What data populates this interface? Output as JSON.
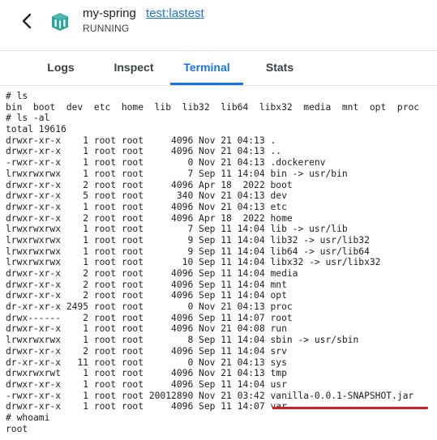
{
  "header": {
    "app_name": "my-spring",
    "image_tag": "test:lastest",
    "status": "RUNNING",
    "back_icon": "chevron-left-icon",
    "app_icon": "container-icon",
    "app_icon_color": "#26a69a"
  },
  "tabs": [
    {
      "label": "Logs"
    },
    {
      "label": "Inspect"
    },
    {
      "label": "Terminal",
      "active": true
    },
    {
      "label": "Stats"
    }
  ],
  "accent_color": "#1a73e8",
  "highlight_color": "#d01c1f",
  "terminal": {
    "lines": [
      "# ls",
      "bin  boot  dev  etc  home  lib  lib32  lib64  libx32  media  mnt  opt  proc",
      "# ls -al",
      "total 19616",
      "drwxr-xr-x    1 root root     4096 Nov 21 04:13 .",
      "drwxr-xr-x    1 root root     4096 Nov 21 04:13 ..",
      "-rwxr-xr-x    1 root root        0 Nov 21 04:13 .dockerenv",
      "lrwxrwxrwx    1 root root        7 Sep 11 14:04 bin -> usr/bin",
      "drwxr-xr-x    2 root root     4096 Apr 18  2022 boot",
      "drwxr-xr-x    5 root root      340 Nov 21 04:13 dev",
      "drwxr-xr-x    1 root root     4096 Nov 21 04:13 etc",
      "drwxr-xr-x    2 root root     4096 Apr 18  2022 home",
      "lrwxrwxrwx    1 root root        7 Sep 11 14:04 lib -> usr/lib",
      "lrwxrwxrwx    1 root root        9 Sep 11 14:04 lib32 -> usr/lib32",
      "lrwxrwxrwx    1 root root        9 Sep 11 14:04 lib64 -> usr/lib64",
      "lrwxrwxrwx    1 root root       10 Sep 11 14:04 libx32 -> usr/libx32",
      "drwxr-xr-x    2 root root     4096 Sep 11 14:04 media",
      "drwxr-xr-x    2 root root     4096 Sep 11 14:04 mnt",
      "drwxr-xr-x    2 root root     4096 Sep 11 14:04 opt",
      "dr-xr-xr-x 2495 root root        0 Nov 21 04:13 proc",
      "drwx------    2 root root     4096 Sep 11 14:07 root",
      "drwxr-xr-x    1 root root     4096 Nov 21 04:08 run",
      "lrwxrwxrwx    1 root root        8 Sep 11 14:04 sbin -> usr/sbin",
      "drwxr-xr-x    2 root root     4096 Sep 11 14:04 srv",
      "dr-xr-xr-x   11 root root        0 Nov 21 04:13 sys",
      "drwxrwxrwt    1 root root     4096 Nov 21 04:13 tmp",
      "drwxr-xr-x    1 root root     4096 Sep 11 14:04 usr",
      "-rwxr-xr-x    1 root root 20012890 Nov 21 03:42 vanilla-0.0.1-SNAPSHOT.jar",
      "drwxr-xr-x    1 root root     4096 Sep 11 14:07 var",
      "# whoami",
      "root"
    ]
  }
}
